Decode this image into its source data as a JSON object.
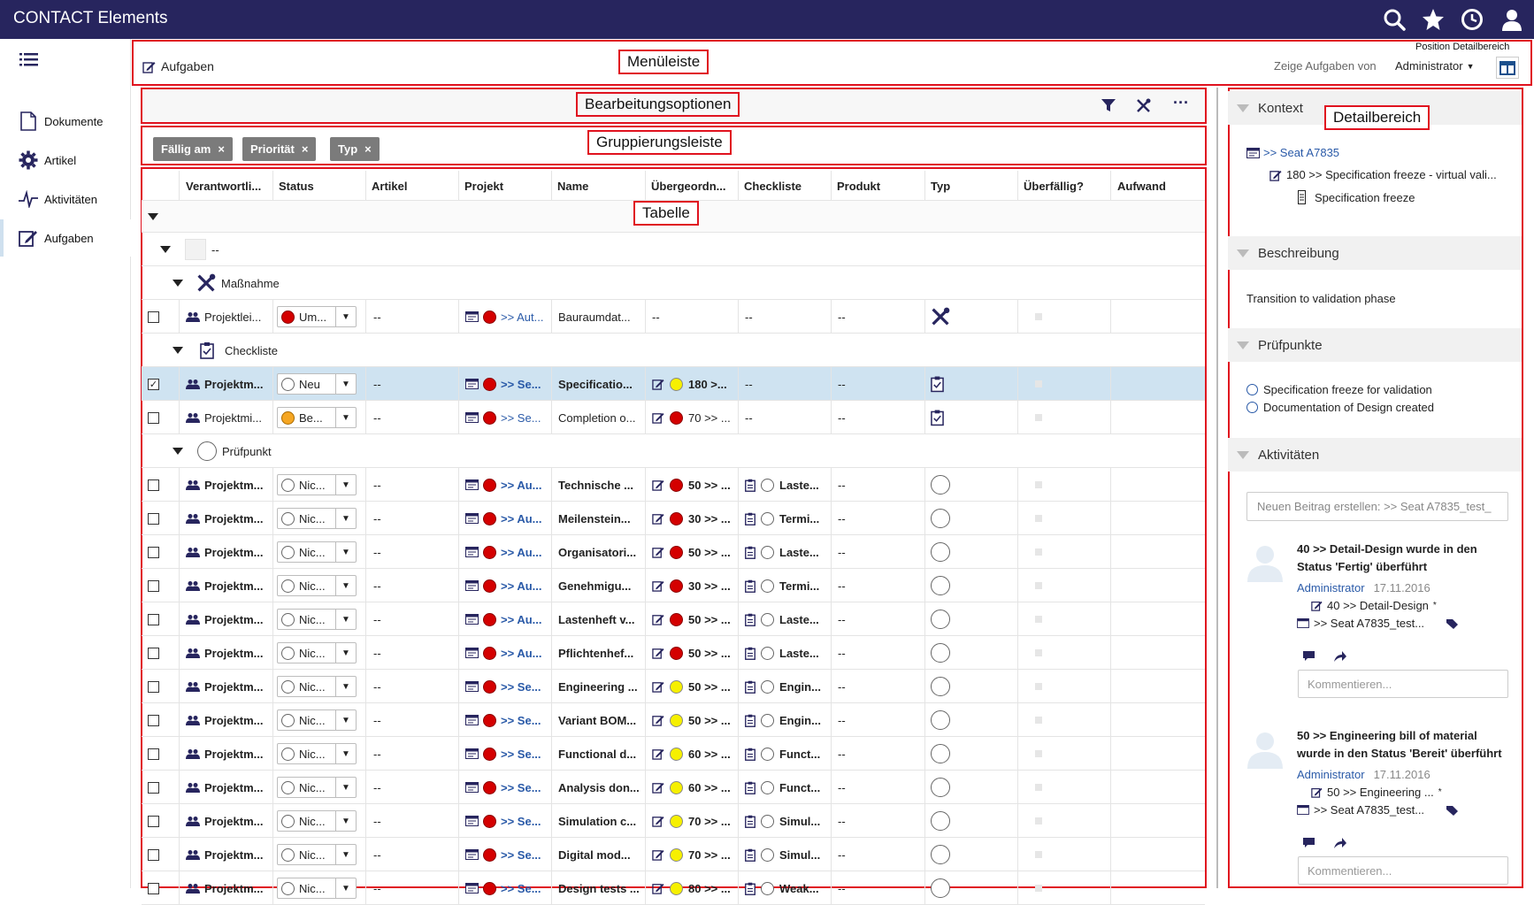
{
  "app": {
    "title": "CONTACT Elements"
  },
  "nav": [
    {
      "label": "Dokumente",
      "icon": "document-icon"
    },
    {
      "label": "Artikel",
      "icon": "gear-icon"
    },
    {
      "label": "Aktivitäten",
      "icon": "activity-icon"
    },
    {
      "label": "Aufgaben",
      "icon": "edit-icon"
    }
  ],
  "menubar": {
    "page_label": "Aufgaben",
    "show_tasks_label": "Zeige Aufgaben von",
    "user_select": "Administrator",
    "position_label": "Position Detailbereich"
  },
  "annotations": {
    "menubar": "Menüleiste",
    "edit_options": "Bearbeitungsoptionen",
    "grouping": "Gruppierungsleiste",
    "table": "Tabelle",
    "detail": "Detailbereich"
  },
  "chips": [
    "Fällig am",
    "Priorität",
    "Typ"
  ],
  "columns": [
    "Verantwortli...",
    "Status",
    "Artikel",
    "Projekt",
    "Name",
    "Übergeordn...",
    "Checkliste",
    "Produkt",
    "Typ",
    "Überfällig?",
    "Aufwand"
  ],
  "groups": {
    "empty": "--",
    "massnahme": "Maßnahme",
    "checkliste": "Checkliste",
    "pruefpunkt": "Prüfpunkt"
  },
  "rows": [
    {
      "resp": "Projektlei...",
      "status": "Um...",
      "status_color": "red",
      "artikel": "--",
      "projekt": ">> Aut...",
      "name": "Bauraumdat...",
      "parent": "--",
      "parent_color": "",
      "check": "--",
      "check_ring": false,
      "produkt": "--",
      "typ": "tools",
      "bold": false,
      "checked": false,
      "selected": false
    },
    {
      "resp": "Projektm...",
      "status": "Neu",
      "status_color": "ring",
      "artikel": "--",
      "projekt": ">> Se...",
      "name": "Specificatio...",
      "parent": "180 >...",
      "parent_color": "yel",
      "check": "--",
      "check_ring": false,
      "produkt": "--",
      "typ": "clipboard",
      "bold": true,
      "checked": true,
      "selected": true
    },
    {
      "resp": "Projektmi...",
      "status": "Be...",
      "status_color": "org",
      "artikel": "--",
      "projekt": ">> Se...",
      "name": "Completion o...",
      "parent": "70 >> ...",
      "parent_color": "red",
      "check": "--",
      "check_ring": false,
      "produkt": "--",
      "typ": "clipboard",
      "bold": false,
      "checked": false,
      "selected": false
    },
    {
      "resp": "Projektm...",
      "status": "Nic...",
      "status_color": "ring",
      "artikel": "--",
      "projekt": ">> Au...",
      "name": "Technische ...",
      "parent": "50 >> ...",
      "parent_color": "red",
      "check": "Laste...",
      "check_ring": true,
      "produkt": "--",
      "typ": "circle",
      "bold": true,
      "checked": false,
      "selected": false
    },
    {
      "resp": "Projektm...",
      "status": "Nic...",
      "status_color": "ring",
      "artikel": "--",
      "projekt": ">> Au...",
      "name": "Meilenstein...",
      "parent": "30 >> ...",
      "parent_color": "red",
      "check": "Termi...",
      "check_ring": true,
      "produkt": "--",
      "typ": "circle",
      "bold": true,
      "checked": false,
      "selected": false
    },
    {
      "resp": "Projektm...",
      "status": "Nic...",
      "status_color": "ring",
      "artikel": "--",
      "projekt": ">> Au...",
      "name": "Organisatori...",
      "parent": "50 >> ...",
      "parent_color": "red",
      "check": "Laste...",
      "check_ring": true,
      "produkt": "--",
      "typ": "circle",
      "bold": true,
      "checked": false,
      "selected": false
    },
    {
      "resp": "Projektm...",
      "status": "Nic...",
      "status_color": "ring",
      "artikel": "--",
      "projekt": ">> Au...",
      "name": "Genehmigu...",
      "parent": "30 >> ...",
      "parent_color": "red",
      "check": "Termi...",
      "check_ring": true,
      "produkt": "--",
      "typ": "circle",
      "bold": true,
      "checked": false,
      "selected": false
    },
    {
      "resp": "Projektm...",
      "status": "Nic...",
      "status_color": "ring",
      "artikel": "--",
      "projekt": ">> Au...",
      "name": "Lastenheft v...",
      "parent": "50 >> ...",
      "parent_color": "red",
      "check": "Laste...",
      "check_ring": true,
      "produkt": "--",
      "typ": "circle",
      "bold": true,
      "checked": false,
      "selected": false
    },
    {
      "resp": "Projektm...",
      "status": "Nic...",
      "status_color": "ring",
      "artikel": "--",
      "projekt": ">> Au...",
      "name": "Pflichtenhef...",
      "parent": "50 >> ...",
      "parent_color": "red",
      "check": "Laste...",
      "check_ring": true,
      "produkt": "--",
      "typ": "circle",
      "bold": true,
      "checked": false,
      "selected": false
    },
    {
      "resp": "Projektm...",
      "status": "Nic...",
      "status_color": "ring",
      "artikel": "--",
      "projekt": ">> Se...",
      "name": "Engineering ...",
      "parent": "50 >> ...",
      "parent_color": "yel",
      "check": "Engin...",
      "check_ring": true,
      "produkt": "--",
      "typ": "circle",
      "bold": true,
      "checked": false,
      "selected": false
    },
    {
      "resp": "Projektm...",
      "status": "Nic...",
      "status_color": "ring",
      "artikel": "--",
      "projekt": ">> Se...",
      "name": "Variant BOM...",
      "parent": "50 >> ...",
      "parent_color": "yel",
      "check": "Engin...",
      "check_ring": true,
      "produkt": "--",
      "typ": "circle",
      "bold": true,
      "checked": false,
      "selected": false
    },
    {
      "resp": "Projektm...",
      "status": "Nic...",
      "status_color": "ring",
      "artikel": "--",
      "projekt": ">> Se...",
      "name": "Functional d...",
      "parent": "60 >> ...",
      "parent_color": "yel",
      "check": "Funct...",
      "check_ring": true,
      "produkt": "--",
      "typ": "circle",
      "bold": true,
      "checked": false,
      "selected": false
    },
    {
      "resp": "Projektm...",
      "status": "Nic...",
      "status_color": "ring",
      "artikel": "--",
      "projekt": ">> Se...",
      "name": "Analysis don...",
      "parent": "60 >> ...",
      "parent_color": "yel",
      "check": "Funct...",
      "check_ring": true,
      "produkt": "--",
      "typ": "circle",
      "bold": true,
      "checked": false,
      "selected": false
    },
    {
      "resp": "Projektm...",
      "status": "Nic...",
      "status_color": "ring",
      "artikel": "--",
      "projekt": ">> Se...",
      "name": "Simulation c...",
      "parent": "70 >> ...",
      "parent_color": "yel",
      "check": "Simul...",
      "check_ring": true,
      "produkt": "--",
      "typ": "circle",
      "bold": true,
      "checked": false,
      "selected": false
    },
    {
      "resp": "Projektm...",
      "status": "Nic...",
      "status_color": "ring",
      "artikel": "--",
      "projekt": ">> Se...",
      "name": "Digital mod...",
      "parent": "70 >> ...",
      "parent_color": "yel",
      "check": "Simul...",
      "check_ring": true,
      "produkt": "--",
      "typ": "circle",
      "bold": true,
      "checked": false,
      "selected": false
    },
    {
      "resp": "Projektm...",
      "status": "Nic...",
      "status_color": "ring",
      "artikel": "--",
      "projekt": ">> Se...",
      "name": "Design tests ...",
      "parent": "80 >> ...",
      "parent_color": "yel",
      "check": "Weak...",
      "check_ring": true,
      "produkt": "--",
      "typ": "circle",
      "bold": true,
      "checked": false,
      "selected": false
    }
  ],
  "detail": {
    "kontext_title": "Kontext",
    "kontext_items": [
      ">> Seat A7835",
      "180 >> Specification freeze - virtual vali...",
      "Specification freeze"
    ],
    "beschreibung_title": "Beschreibung",
    "beschreibung_text": "Transition to validation phase",
    "pruefpunkte_title": "Prüfpunkte",
    "pruefpunkte": [
      "Specification freeze for validation",
      "Documentation of Design created"
    ],
    "aktivitaeten_title": "Aktivitäten",
    "new_post_placeholder": "Neuen Beitrag erstellen:  >>  Seat A7835_test_",
    "activities": [
      {
        "title": "40 >> Detail-Design wurde in den Status 'Fertig' überführt",
        "title_l1": "40 >> Detail-Design wurde in den",
        "title_l2": "Status 'Fertig' überführt",
        "author": "Administrator",
        "date": "17.11.2016",
        "ref1": "40 >> Detail-Design",
        "ref2": ">> Seat A7835_test...",
        "comment_placeholder": "Kommentieren..."
      },
      {
        "title": "50 >> Engineering bill of material wurde in den Status 'Bereit' überführt",
        "title_l1": "50 >> Engineering bill of material",
        "title_l2": "wurde in den Status 'Bereit' überführt",
        "author": "Administrator",
        "date": "17.11.2016",
        "ref1": "50 >> Engineering ...",
        "ref2": ">> Seat A7835_test...",
        "comment_placeholder": "Kommentieren..."
      }
    ]
  }
}
